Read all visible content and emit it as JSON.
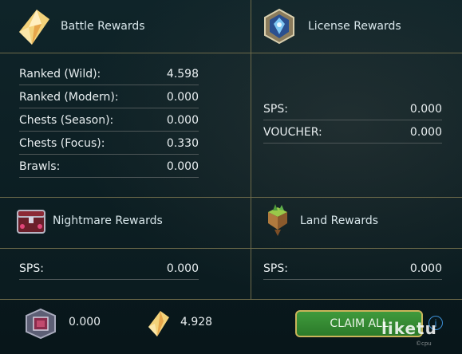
{
  "battle": {
    "title": "Battle Rewards",
    "icon": "crystal-shard-icon",
    "rows": [
      {
        "label": "Ranked (Wild):",
        "value": "4.598"
      },
      {
        "label": "Ranked (Modern):",
        "value": "0.000"
      },
      {
        "label": "Chests (Season):",
        "value": "0.000"
      },
      {
        "label": "Chests (Focus):",
        "value": "0.330"
      },
      {
        "label": "Brawls:",
        "value": "0.000"
      }
    ]
  },
  "license": {
    "title": "License Rewards",
    "icon": "license-gem-icon",
    "rows": [
      {
        "label": "SPS:",
        "value": "0.000"
      },
      {
        "label": "VOUCHER:",
        "value": "0.000"
      }
    ]
  },
  "nightmare": {
    "title": "Nightmare Rewards",
    "icon": "nightmare-chest-icon",
    "rows": [
      {
        "label": "SPS:",
        "value": "0.000"
      }
    ]
  },
  "land": {
    "title": "Land Rewards",
    "icon": "floating-island-icon",
    "rows": [
      {
        "label": "SPS:",
        "value": "0.000"
      }
    ]
  },
  "footer": {
    "sps_total": "0.000",
    "shard_total": "4.928",
    "claim_label": "CLAIM ALL",
    "info_icon": "info-icon"
  },
  "watermark": {
    "text": "liketu",
    "sub": "©cpu"
  },
  "colors": {
    "divider": "#6d6a4a",
    "claim_green": "#3a8f36",
    "claim_border": "#c9b45a",
    "info_blue": "#3c8fd6"
  }
}
